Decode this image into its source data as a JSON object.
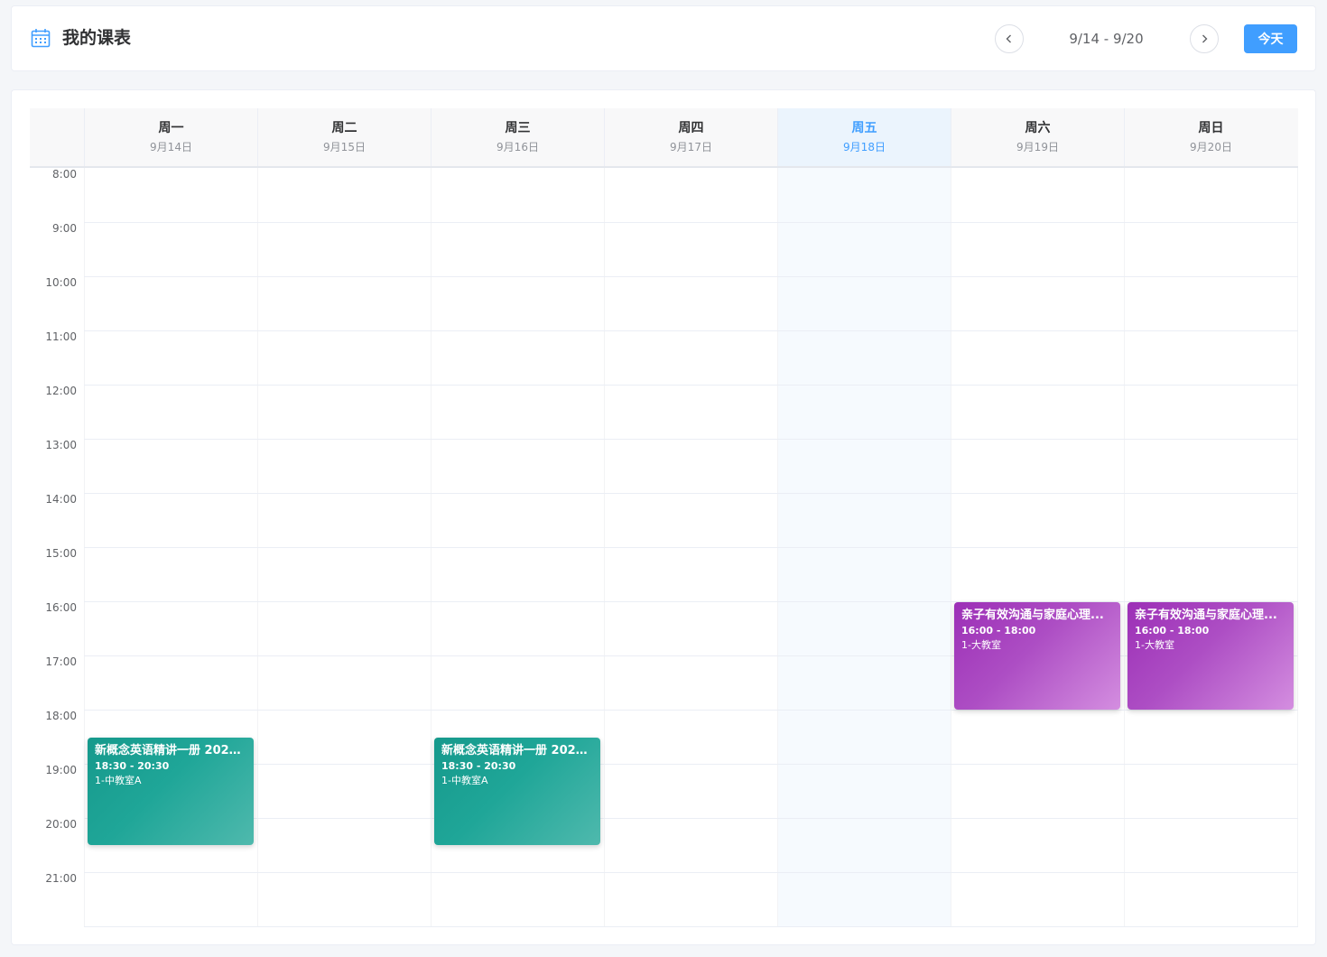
{
  "header": {
    "title": "我的课表",
    "icon": "calendar-icon",
    "range": "9/14 - 9/20",
    "today_label": "今天",
    "prev_icon": "chevron-left-icon",
    "next_icon": "chevron-right-icon"
  },
  "days": [
    {
      "name": "周一",
      "date": "9月14日"
    },
    {
      "name": "周二",
      "date": "9月15日"
    },
    {
      "name": "周三",
      "date": "9月16日"
    },
    {
      "name": "周四",
      "date": "9月17日"
    },
    {
      "name": "周五",
      "date": "9月18日"
    },
    {
      "name": "周六",
      "date": "9月19日"
    },
    {
      "name": "周日",
      "date": "9月20日"
    }
  ],
  "today_index": 4,
  "hours": [
    "8:00",
    "9:00",
    "10:00",
    "11:00",
    "12:00",
    "13:00",
    "14:00",
    "15:00",
    "16:00",
    "17:00",
    "18:00",
    "19:00",
    "20:00",
    "21:00"
  ],
  "events": [
    {
      "day": 0,
      "title": "新概念英语精讲一册 2026...",
      "time": "18:30 - 20:30",
      "room": "1-中教室A",
      "start": 18.5,
      "end": 20.5,
      "color": "teal"
    },
    {
      "day": 2,
      "title": "新概念英语精讲一册 2026...",
      "time": "18:30 - 20:30",
      "room": "1-中教室A",
      "start": 18.5,
      "end": 20.5,
      "color": "teal"
    },
    {
      "day": 5,
      "title": "亲子有效沟通与家庭心理...",
      "time": "16:00 - 18:00",
      "room": "1-大教室",
      "start": 16,
      "end": 18,
      "color": "purple"
    },
    {
      "day": 6,
      "title": "亲子有效沟通与家庭心理...",
      "time": "16:00 - 18:00",
      "room": "1-大教室",
      "start": 16,
      "end": 18,
      "color": "purple"
    }
  ],
  "colors": {
    "accent": "#409eff",
    "teal": "#1fa698",
    "purple": "#ad4ec4"
  }
}
